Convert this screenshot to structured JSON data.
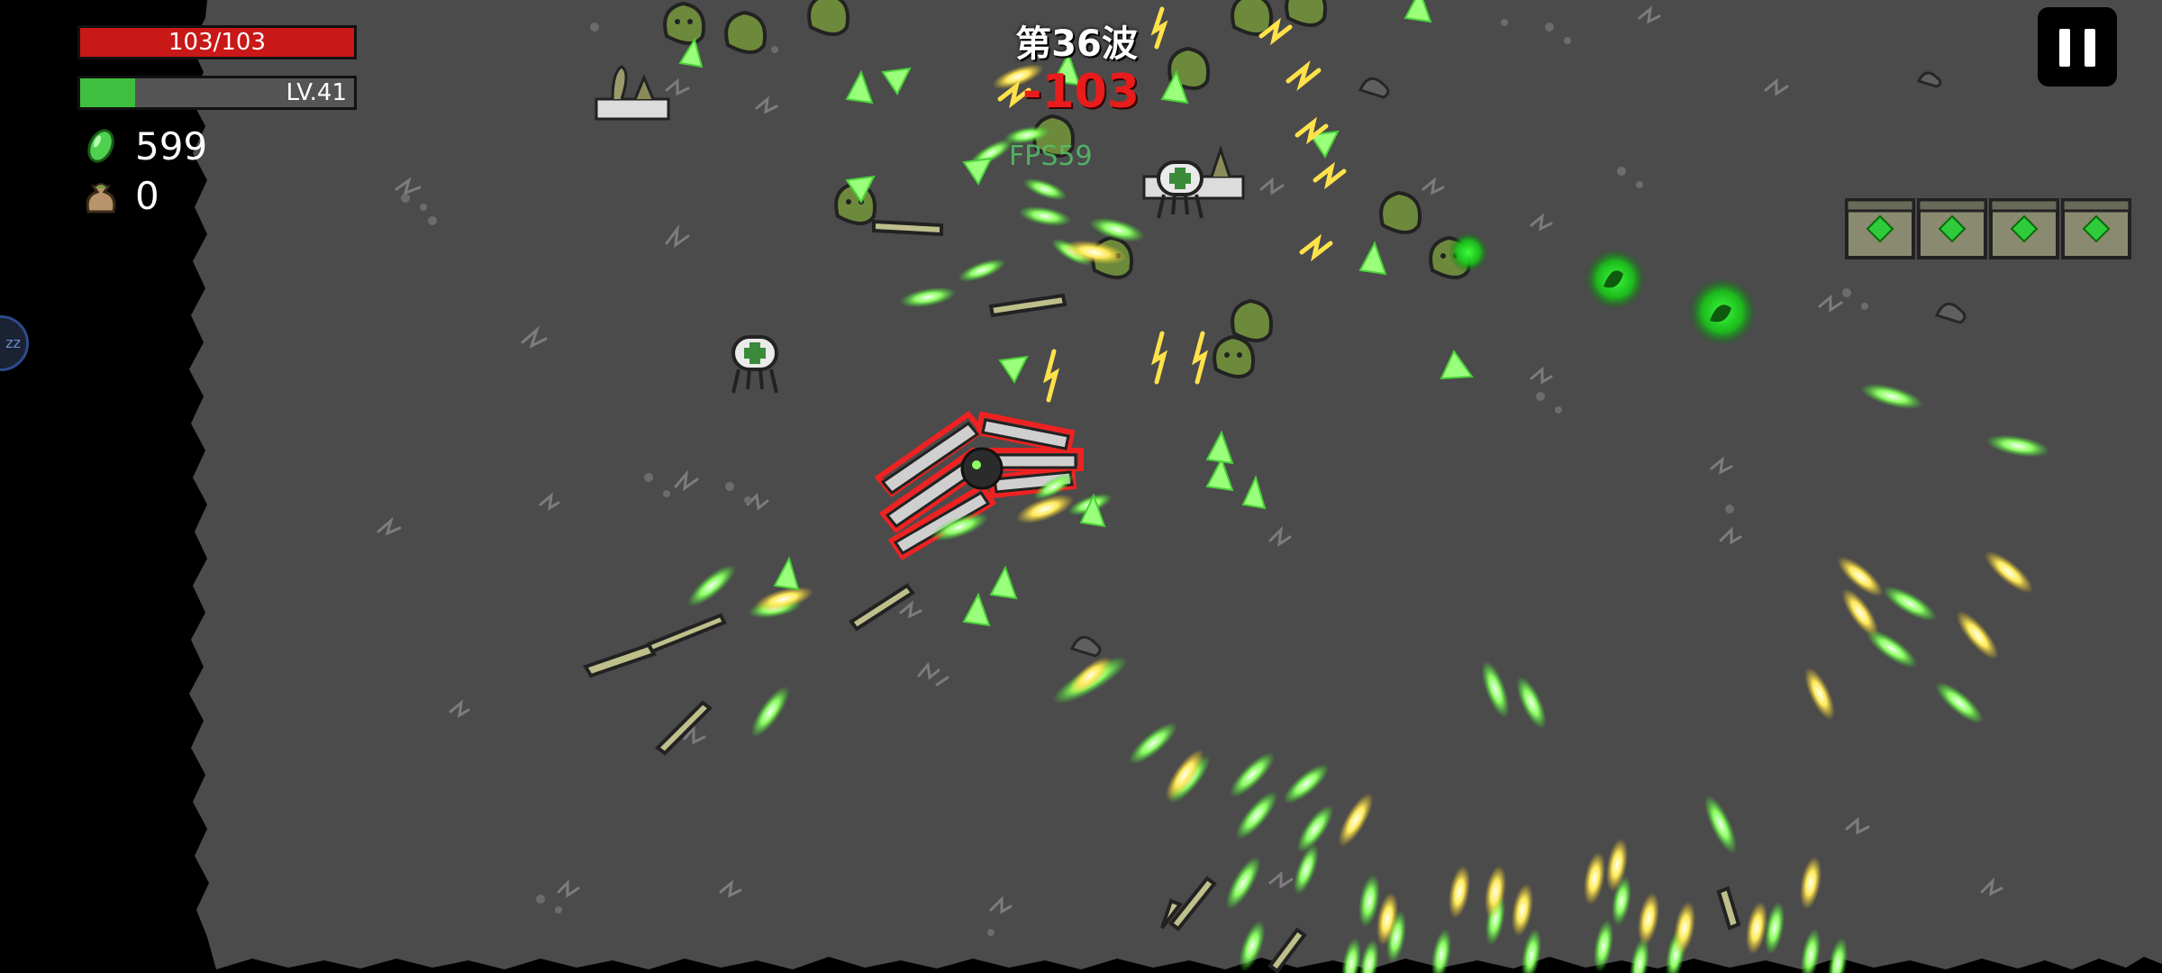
{
  "hud": {
    "hp_text": "103/103",
    "hp_fraction": 1.0,
    "level_text": "LV.41",
    "xp_fraction": 0.2,
    "gems": "599",
    "bags": "0",
    "gem_icon": "green-gem-icon",
    "bag_icon": "money-bag-icon"
  },
  "wave": {
    "label": "第36波"
  },
  "combat": {
    "damage_number": "-103",
    "fps_label": "FPS59"
  },
  "controls": {
    "pause_icon": "pause-icon"
  },
  "side_orb_text": "zz",
  "colors": {
    "arena": "#4b4b4b",
    "hp": "#c81818",
    "xp": "#3fbf3f",
    "projectile_green": "#7dff5a",
    "projectile_yellow": "#ffe85a",
    "damage": "#e81c1c"
  }
}
